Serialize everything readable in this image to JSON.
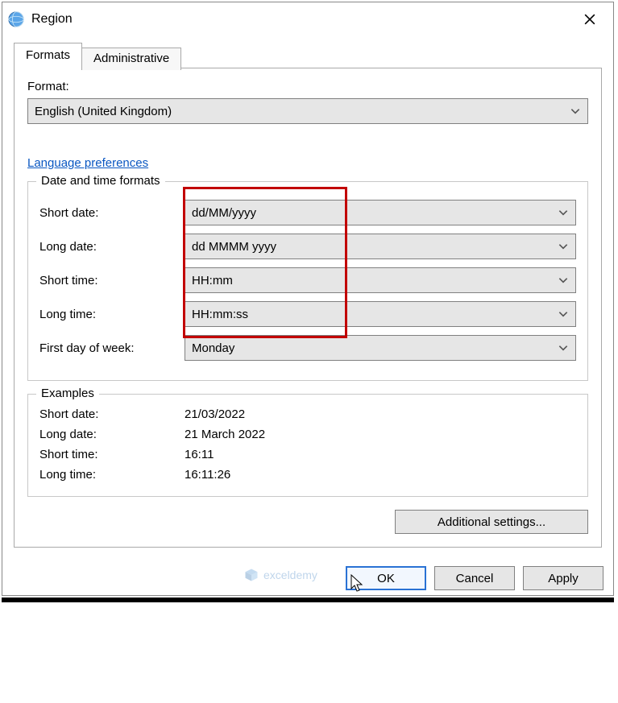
{
  "window": {
    "title": "Region"
  },
  "tabs": {
    "formats": "Formats",
    "administrative": "Administrative"
  },
  "formatSection": {
    "label": "Format:",
    "value": "English (United Kingdom)"
  },
  "languagePrefs": "Language preferences",
  "dateTimeFormats": {
    "legend": "Date and time formats",
    "shortDateLabel": "Short date:",
    "shortDateValue": "dd/MM/yyyy",
    "longDateLabel": "Long date:",
    "longDateValue": "dd MMMM yyyy",
    "shortTimeLabel": "Short time:",
    "shortTimeValue": "HH:mm",
    "longTimeLabel": "Long time:",
    "longTimeValue": "HH:mm:ss",
    "firstDayLabel": "First day of week:",
    "firstDayValue": "Monday"
  },
  "examples": {
    "legend": "Examples",
    "shortDateLabel": "Short date:",
    "shortDateValue": "21/03/2022",
    "longDateLabel": "Long date:",
    "longDateValue": "21 March 2022",
    "shortTimeLabel": "Short time:",
    "shortTimeValue": "16:11",
    "longTimeLabel": "Long time:",
    "longTimeValue": "16:11:26"
  },
  "buttons": {
    "additional": "Additional settings...",
    "ok": "OK",
    "cancel": "Cancel",
    "apply": "Apply"
  },
  "watermark": "exceldemy"
}
